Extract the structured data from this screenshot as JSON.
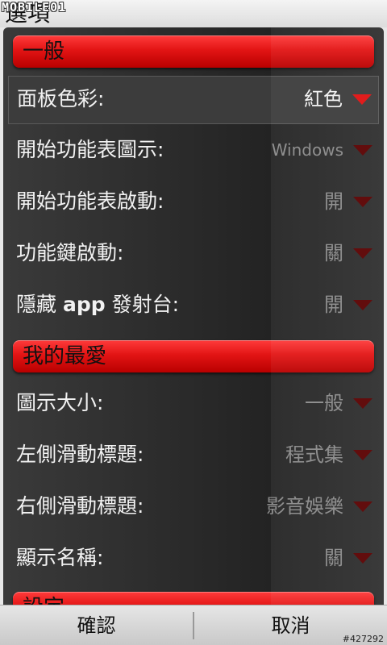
{
  "header": {
    "title": "選項",
    "watermark": "MOBILE01"
  },
  "sections": {
    "general": {
      "title": "一般",
      "rows": [
        {
          "label": "面板色彩:",
          "value": "紅色"
        },
        {
          "label": "開始功能表圖示:",
          "value": "Windows"
        },
        {
          "label": "開始功能表啟動:",
          "value": "開"
        },
        {
          "label": "功能鍵啟動:",
          "value": "關"
        },
        {
          "label_text": "隱藏 ",
          "label_bold": "app",
          "label_suffix": " 發射台:",
          "value": "開"
        }
      ]
    },
    "favorites": {
      "title": "我的最愛",
      "rows": [
        {
          "label": "圖示大小:",
          "value": "一般"
        },
        {
          "label": "左側滑動標題:",
          "value": "程式集"
        },
        {
          "label": "右側滑動標題:",
          "value": "影音娛樂"
        },
        {
          "label": "顯示名稱:",
          "value": "關"
        }
      ]
    },
    "settings": {
      "title": "設定"
    }
  },
  "softkeys": {
    "left": "確認",
    "right": "取消"
  },
  "footer_tag": "#427292",
  "colors": {
    "accent": "#e21414",
    "arrow_inactive": "#5a0000",
    "arrow_active": "#e01010"
  }
}
